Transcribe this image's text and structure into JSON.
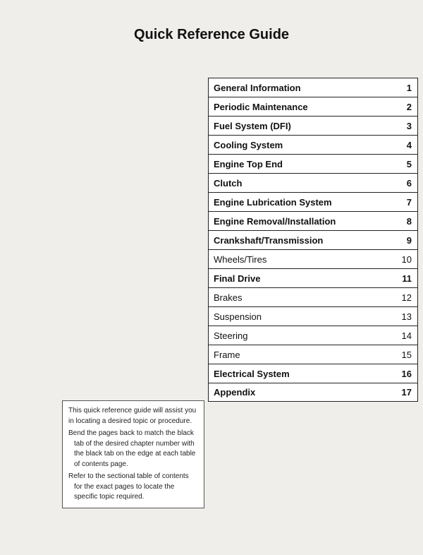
{
  "title": "Quick Reference Guide",
  "toc": {
    "items": [
      {
        "label": "General Information",
        "number": "1",
        "bold": true
      },
      {
        "label": "Periodic Maintenance",
        "number": "2",
        "bold": true
      },
      {
        "label": "Fuel System (DFI)",
        "number": "3",
        "bold": true
      },
      {
        "label": "Cooling System",
        "number": "4",
        "bold": true
      },
      {
        "label": "Engine Top End",
        "number": "5",
        "bold": true
      },
      {
        "label": "Clutch",
        "number": "6",
        "bold": true
      },
      {
        "label": "Engine Lubrication System",
        "number": "7",
        "bold": true
      },
      {
        "label": "Engine Removal/Installation",
        "number": "8",
        "bold": true
      },
      {
        "label": "Crankshaft/Transmission",
        "number": "9",
        "bold": true
      },
      {
        "label": "Wheels/Tires",
        "number": "10",
        "bold": false
      },
      {
        "label": "Final Drive",
        "number": "11",
        "bold": true
      },
      {
        "label": "Brakes",
        "number": "12",
        "bold": false
      },
      {
        "label": "Suspension",
        "number": "13",
        "bold": false
      },
      {
        "label": "Steering",
        "number": "14",
        "bold": false
      },
      {
        "label": "Frame",
        "number": "15",
        "bold": false
      },
      {
        "label": "Electrical System",
        "number": "16",
        "bold": true
      },
      {
        "label": "Appendix",
        "number": "17",
        "bold": true
      }
    ]
  },
  "note": {
    "intro": "This quick reference guide will assist you in locating a desired topic or procedure.",
    "bullet1": "Bend the pages back to match the black tab of the desired chapter number with the black tab on the edge at each table of contents page.",
    "bullet2": "Refer to the sectional table of contents for the exact pages to locate the specific topic required."
  }
}
